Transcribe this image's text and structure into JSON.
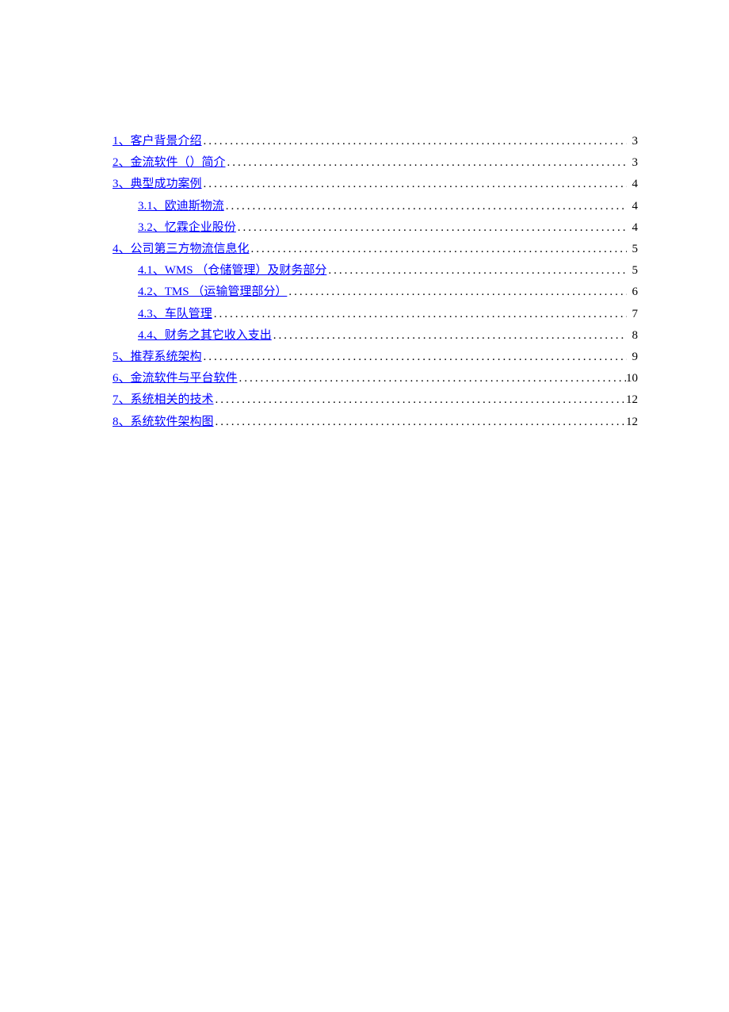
{
  "toc": [
    {
      "level": 1,
      "label": "1、客户背景介绍",
      "page": "3"
    },
    {
      "level": 1,
      "label": "2、金流软件（）简介",
      "page": "3"
    },
    {
      "level": 1,
      "label": "3、典型成功案例",
      "page": "4"
    },
    {
      "level": 2,
      "label": "3.1、欧迪斯物流",
      "page": "4",
      "pad": true
    },
    {
      "level": 2,
      "label": "3.2、忆霖企业股份",
      "page": "4"
    },
    {
      "level": 1,
      "label": "4、公司第三方物流信息化",
      "page": "5"
    },
    {
      "level": 2,
      "label": "4.1、WMS （仓储管理）及财务部分",
      "page": "5"
    },
    {
      "level": 2,
      "label": "4.2、TMS （运输管理部分）",
      "page": "6"
    },
    {
      "level": 2,
      "label": "4.3、车队管理",
      "page": "7"
    },
    {
      "level": 2,
      "label": "4.4、财务之其它收入支出",
      "page": "8"
    },
    {
      "level": 1,
      "label": "5、推荐系统架构",
      "page": "9"
    },
    {
      "level": 1,
      "label": "6、金流软件与平台软件",
      "page": "10"
    },
    {
      "level": 1,
      "label": "7、系统相关的技术",
      "page": "12"
    },
    {
      "level": 1,
      "label": "8、系统软件架构图",
      "page": "12"
    }
  ]
}
